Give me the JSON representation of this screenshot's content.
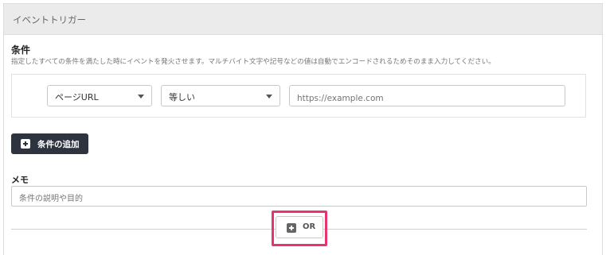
{
  "panel": {
    "title": "イベントトリガー"
  },
  "condition": {
    "title": "条件",
    "description": "指定したすべての条件を満たした時にイベントを発火させます。マルチバイト文字や記号などの値は自動でエンコードされるためそのまま入力してください。",
    "type_select": {
      "selected": "ページURL"
    },
    "operator_select": {
      "selected": "等しい"
    },
    "value_input": {
      "value": "",
      "placeholder": "https://example.com"
    }
  },
  "add_condition_button": {
    "label": "条件の追加",
    "icon": "plus-square-icon"
  },
  "memo": {
    "label": "メモ",
    "input": {
      "value": "",
      "placeholder": "条件の説明や目的"
    }
  },
  "or_button": {
    "label": "OR",
    "icon": "plus-square-icon"
  },
  "colors": {
    "header_bg": "#ebebeb",
    "dark_button": "#2e3340",
    "highlight": "#e8336d"
  }
}
